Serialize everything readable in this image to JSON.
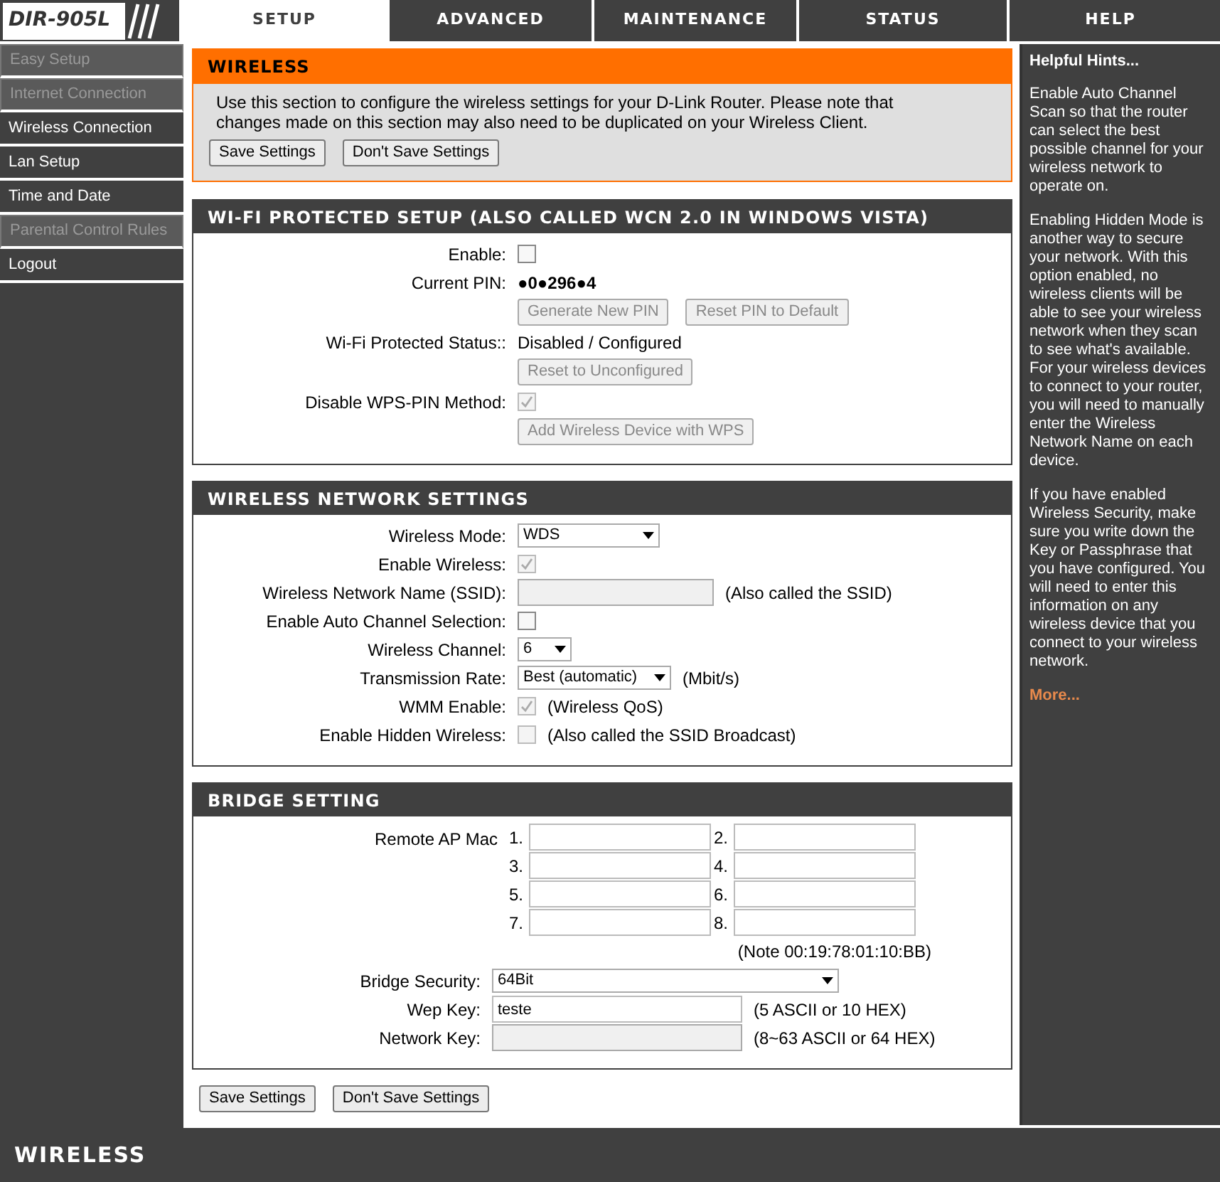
{
  "logo": {
    "text": "DIR-905L"
  },
  "tabs": [
    {
      "label": "SETUP",
      "selected": true
    },
    {
      "label": "ADVANCED",
      "selected": false
    },
    {
      "label": "MAINTENANCE",
      "selected": false
    },
    {
      "label": "STATUS",
      "selected": false
    },
    {
      "label": "HELP",
      "selected": false
    }
  ],
  "sidebar": {
    "items": [
      {
        "label": "Easy Setup",
        "disabled": true
      },
      {
        "label": "Internet Connection",
        "disabled": true
      },
      {
        "label": "Wireless Connection",
        "disabled": false
      },
      {
        "label": "Lan Setup",
        "disabled": false
      },
      {
        "label": "Time and Date",
        "disabled": false
      },
      {
        "label": "Parental Control Rules",
        "disabled": true
      },
      {
        "label": "Logout",
        "disabled": false
      }
    ]
  },
  "intro": {
    "title": "WIRELESS",
    "text": "Use this section to configure the wireless settings for your D-Link Router. Please note that changes made on this section may also need to be duplicated on your Wireless Client.",
    "buttons": [
      "Save Settings",
      "Don't Save Settings"
    ]
  },
  "sections": [
    {
      "title": "WI-FI PROTECTED SETUP (ALSO CALLED WCN 2.0 IN WINDOWS VISTA)",
      "rows": [
        {
          "kind": "checkbox",
          "label": "Enable:",
          "checked": false,
          "disabled": false
        },
        {
          "kind": "text",
          "label": "Current PIN:",
          "value": "●0●296●4"
        },
        {
          "kind": "buttons",
          "buttons": [
            "Generate New PIN",
            "Reset PIN to Default"
          ],
          "disabled": true
        },
        {
          "kind": "text",
          "label": "Wi-Fi Protected Status::",
          "value": "Disabled / Configured"
        },
        {
          "kind": "buttons",
          "buttons": [
            "Reset to Unconfigured"
          ],
          "disabled": true
        },
        {
          "kind": "checkbox",
          "label": "Disable WPS-PIN Method:",
          "checked": true,
          "disabled": true
        },
        {
          "kind": "buttons",
          "buttons": [
            "Add Wireless Device with WPS"
          ],
          "disabled": true
        }
      ]
    },
    {
      "title": "WIRELESS NETWORK SETTINGS",
      "rows": [
        {
          "kind": "select",
          "label": "Wireless Mode:",
          "value": "WDS"
        },
        {
          "kind": "checkbox",
          "label": "Enable Wireless:",
          "checked": true,
          "disabled": true
        },
        {
          "kind": "input",
          "label": "Wireless Network Name (SSID):",
          "disabled": true,
          "note": "(Also called the SSID)"
        },
        {
          "kind": "checkbox",
          "label": "Enable Auto Channel Selection:",
          "checked": false,
          "disabled": false
        },
        {
          "kind": "select",
          "label": "Wireless Channel:",
          "value": "6"
        },
        {
          "kind": "select",
          "label": "Transmission Rate:",
          "value": "Best (automatic)",
          "note": "(Mbit/s)"
        },
        {
          "kind": "checkbox",
          "label": "WMM Enable:",
          "checked": true,
          "disabled": true,
          "note": "(Wireless QoS)"
        },
        {
          "kind": "checkbox",
          "label": "Enable Hidden Wireless:",
          "checked": false,
          "disabled": true,
          "note": "(Also called the SSID Broadcast)"
        }
      ]
    }
  ],
  "bridge": {
    "title": "BRIDGE SETTING",
    "mac_label": "Remote AP Mac",
    "mac_fields": [
      "1.",
      "2.",
      "3.",
      "4.",
      "5.",
      "6.",
      "7.",
      "8."
    ],
    "mac_note": "(Note 00:19:78:01:10:BB)",
    "rows": [
      {
        "kind": "select",
        "label": "Bridge Security:",
        "value": "64Bit"
      },
      {
        "kind": "input",
        "label": "Wep Key:",
        "value": "teste",
        "disabled": false,
        "note": "(5 ASCII or 10 HEX)"
      },
      {
        "kind": "input",
        "label": "Network Key:",
        "disabled": true,
        "note": "(8~63 ASCII or 64 HEX)"
      }
    ]
  },
  "bottom_buttons": [
    "Save Settings",
    "Don't Save Settings"
  ],
  "hints": {
    "title": "Helpful Hints...",
    "paragraphs": [
      "Enable Auto Channel Scan so that the router can select the best possible channel for your wireless network to operate on.",
      "Enabling Hidden Mode is another way to secure your network. With this option enabled, no wireless clients will be able to see your wireless network when they scan to see what's available. For your wireless devices to connect to your router, you will need to manually enter the Wireless Network Name on each device.",
      "If you have enabled Wireless Security, make sure you write down the Key or Passphrase that you have configured. You will need to enter this information on any wireless device that you connect to your wireless network."
    ],
    "link": "More..."
  },
  "footer": {
    "text": "WIRELESS"
  }
}
